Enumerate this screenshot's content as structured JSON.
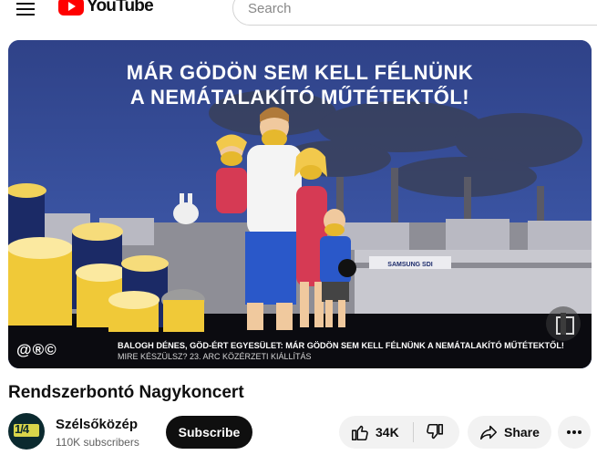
{
  "header": {
    "logo_text": "YouTube",
    "search_placeholder": "Search"
  },
  "video": {
    "headline_line1": "MÁR GÖDÖN SEM KELL FÉLNÜNK",
    "headline_line2": "A NEMÁTALAKÍTÓ MŰTÉTEKTŐL!",
    "watermark": "@®©",
    "caption_line1": "BALOGH DÉNES, GÖD-ÉRT EGYESÜLET: MÁR GÖDÖN SEM KELL FÉLNÜNK A NEMÁTALAKÍTÓ MŰTÉTEKTŐL!",
    "caption_line2": "MIRE KÉSZÜLSZ? 23. ARC KÖZÉRZETI KIÁLLÍTÁS",
    "factory_sign": "SAMSUNG SDI"
  },
  "title": "Rendszerbontó Nagykoncert",
  "channel": {
    "name": "Szélsőközép",
    "subscribers": "110K subscribers",
    "avatar_text": "1/4"
  },
  "actions": {
    "subscribe_label": "Subscribe",
    "like_count": "34K",
    "share_label": "Share"
  },
  "colors": {
    "brand_red": "#ff0000",
    "subscribe_bg": "#0f0f0f",
    "pill_bg": "#f2f2f2",
    "poster_bg": "#2b3f7c"
  }
}
